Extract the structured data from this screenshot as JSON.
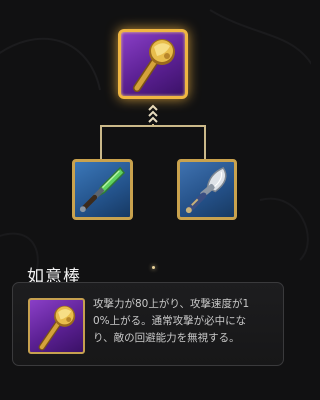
{
  "item": {
    "name": "如意棒",
    "description": "攻撃力が80上がり、攻撃速度が1\n0%上がる。通常攻撃が必中にな\nり、敵の回避能力を無視する。",
    "rarity_color": "#6a2bab",
    "frame_color": "#f0b642",
    "icon": "golden-staff-icon"
  },
  "components": [
    {
      "icon": "green-blade-icon",
      "rarity_color": "#2d62a0"
    },
    {
      "icon": "steel-dagger-icon",
      "rarity_color": "#2d62a0"
    }
  ]
}
